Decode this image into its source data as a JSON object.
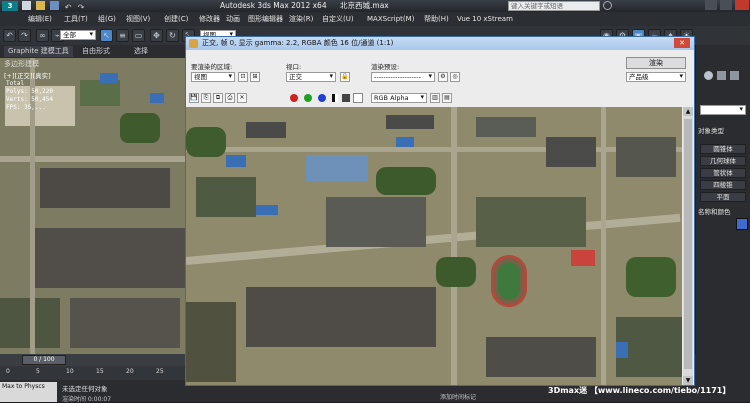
{
  "titlebar": {
    "app_title": "Autodesk 3ds Max  2012 x64",
    "file_name": "北京西城.max",
    "search_placeholder": "键入关键字或短语"
  },
  "menubar": {
    "items": [
      "编辑(E)",
      "工具(T)",
      "组(G)",
      "视图(V)",
      "创建(C)",
      "修改器",
      "动画",
      "图形编辑器",
      "渲染(R)",
      "自定义(U)",
      "MAXScript(M)",
      "帮助(H)",
      "Vue 10 xStream"
    ]
  },
  "toolbar": {
    "selection_filter": "全部",
    "view_select": "视图"
  },
  "ribbon": {
    "tabs": [
      "Graphite 建模工具",
      "自由形式",
      "选择"
    ],
    "sub_label": "多边形建模"
  },
  "viewport": {
    "label": "[+][正交][真实]",
    "stats": [
      {
        "name": "Total",
        "value": ""
      },
      {
        "name": "Polys",
        "value": "50,220"
      },
      {
        "name": "Verts",
        "value": "50,454"
      },
      {
        "name": "FPS",
        "value": "35,..."
      }
    ]
  },
  "right_panel": {
    "section_title": "对象类型",
    "buttons": [
      "圆锥体",
      "几何球体",
      "管状体",
      "四棱锥",
      "平面"
    ],
    "color_section": "名称和颜色",
    "dropdown_value": ""
  },
  "timeline": {
    "frame_label": "0 / 100",
    "ticks": [
      "0",
      "5",
      "10",
      "15",
      "20",
      "25"
    ]
  },
  "statusbar": {
    "script_label": "Max to Physcs",
    "status_text": "未选定任何对象",
    "prompt_text": "渲染时间 0:00:07",
    "watermark": "3Dmax迷 【www.lineco.com/tiebo/1171】",
    "addkey": "添加时间标记"
  },
  "dialog": {
    "title": "正交, 帧 0, 显示 gamma: 2.2, RGBA 颜色 16 位/通道 (1:1)",
    "area_label": "要渲染的区域:",
    "area_value": "视图",
    "viewport_label": "视口:",
    "viewport_value": "正交",
    "preset_label": "渲染预设:",
    "preset_value": "--------------------",
    "render_button": "渲染",
    "quality_value": "产品级",
    "channel_value": "RGB Alpha"
  },
  "colors": {
    "accent": "#3a6ea8",
    "render_ground": "#8f8a6b"
  }
}
